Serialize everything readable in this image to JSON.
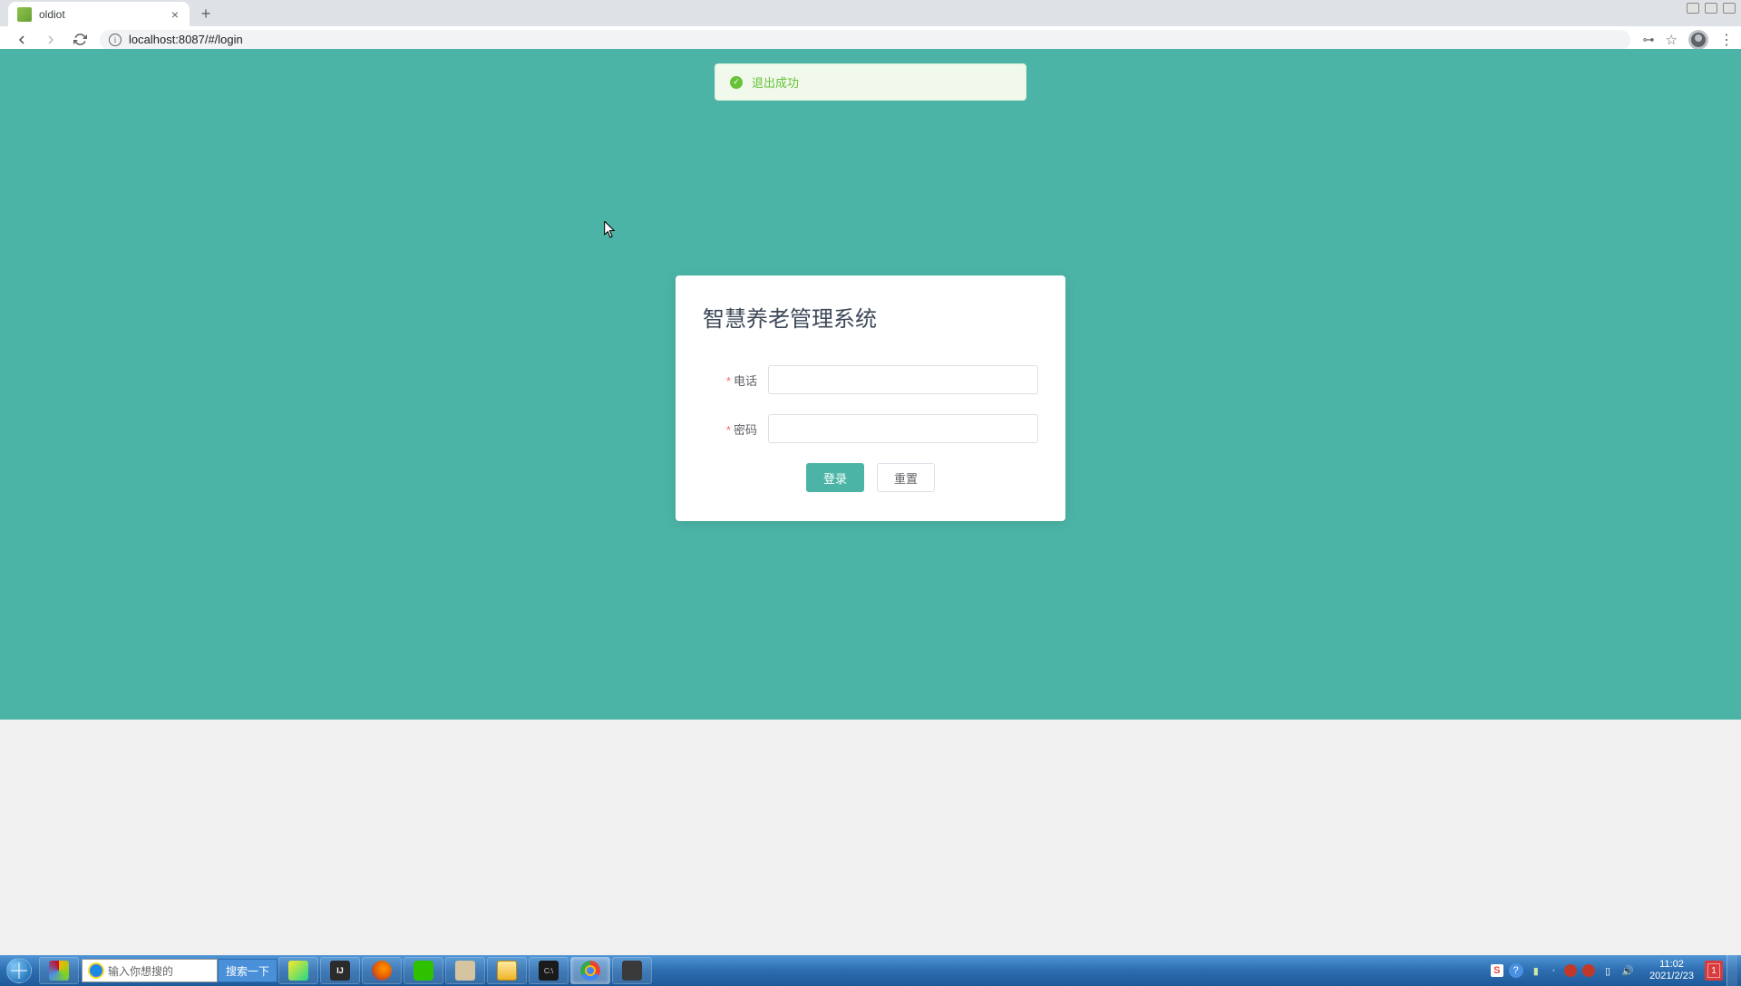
{
  "browser": {
    "tab": {
      "title": "oldiot"
    },
    "url": "localhost:8087/#/login"
  },
  "page": {
    "notification": "退出成功",
    "login_card": {
      "title": "智慧养老管理系统",
      "fields": {
        "phone": {
          "label": "电话",
          "value": ""
        },
        "password": {
          "label": "密码",
          "value": ""
        }
      },
      "buttons": {
        "login": "登录",
        "reset": "重置"
      }
    }
  },
  "taskbar": {
    "search_placeholder": "输入你想搜的",
    "search_button": "搜索一下",
    "clock": {
      "time": "11:02",
      "date": "2021/2/23"
    },
    "notification_count": "1"
  }
}
